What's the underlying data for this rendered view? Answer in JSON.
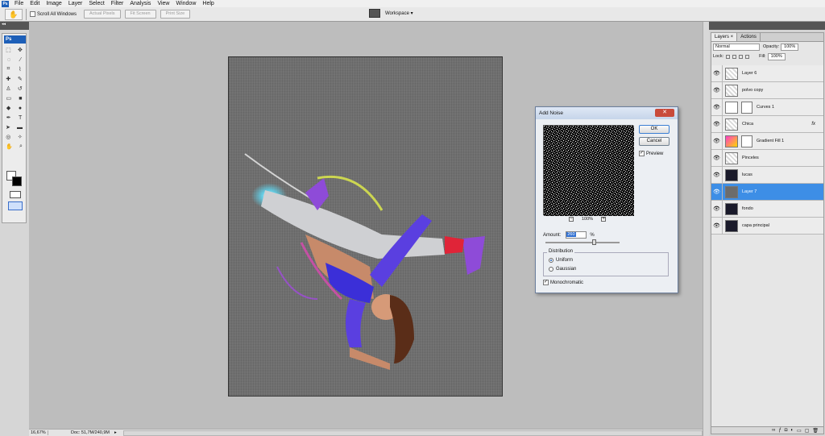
{
  "menubar": {
    "logo": "Ps",
    "items": [
      "File",
      "Edit",
      "Image",
      "Layer",
      "Select",
      "Filter",
      "Analysis",
      "View",
      "Window",
      "Help"
    ]
  },
  "options": {
    "tool_icon": "hand-icon",
    "scroll_all": "Scroll All Windows",
    "actual_pixels": "Actual Pixels",
    "fit_screen": "Fit Screen",
    "print_size": "Print Size",
    "workspace": "Workspace ▾"
  },
  "tools": {
    "logo": "Ps",
    "icons": [
      "move-icon",
      "marquee-icon",
      "lasso-icon",
      "magic-wand-icon",
      "crop-icon",
      "eyedropper-icon",
      "healing-icon",
      "brush-icon",
      "clone-stamp-icon",
      "history-brush-icon",
      "eraser-icon",
      "gradient-icon",
      "blur-icon",
      "dodge-icon",
      "pen-icon",
      "type-icon",
      "path-select-icon",
      "shape-icon",
      "3d-rotate-icon",
      "3d-orbit-icon",
      "hand-icon",
      "zoom-icon"
    ]
  },
  "status": {
    "zoom": "16,67%",
    "doc": "Doc: 51,7M/240,9M"
  },
  "layers_panel": {
    "tab_layers": "Layers ×",
    "tab_actions": "Actions",
    "blend_mode": "Normal",
    "opacity_label": "Opacity:",
    "opacity": "100%",
    "lock_label": "Lock:",
    "fill_label": "Fill:",
    "fill": "100%",
    "layers": [
      {
        "name": "Layer 6",
        "thumb": "check"
      },
      {
        "name": "polvo copy",
        "thumb": "check"
      },
      {
        "name": "Curves 1",
        "thumb": "curve",
        "mask": true
      },
      {
        "name": "Chica",
        "thumb": "check",
        "fx": "fx"
      },
      {
        "name": "Gradient Fill 1",
        "thumb": "grad",
        "mask": true
      },
      {
        "name": "Pinceles",
        "thumb": "check"
      },
      {
        "name": "lucas",
        "thumb": "dark"
      },
      {
        "name": "Layer 7",
        "thumb": "gray",
        "selected": true
      },
      {
        "name": "fondo",
        "thumb": "dark"
      },
      {
        "name": "capa principal",
        "thumb": "dark"
      }
    ]
  },
  "dialog": {
    "title": "Add Noise",
    "ok": "OK",
    "cancel": "Cancel",
    "preview_label": "Preview",
    "zoom_minus": "−",
    "zoom_plus": "+",
    "preview_zoom": "100%",
    "amount_label": "Amount:",
    "amount_value": "260",
    "amount_unit": "%",
    "distribution_label": "Distribution",
    "uniform": "Uniform",
    "gaussian": "Gaussian",
    "monochromatic": "Monochromatic"
  }
}
